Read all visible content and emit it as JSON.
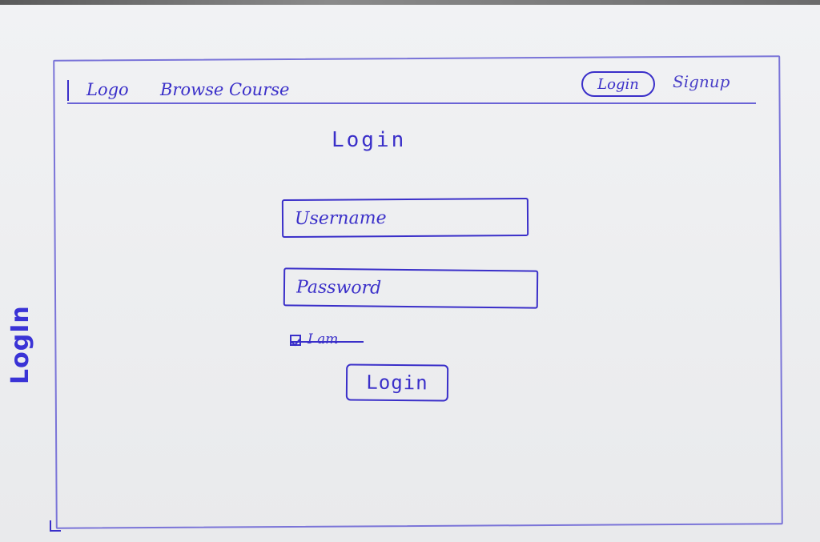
{
  "sketch": {
    "side_title": "LogIn"
  },
  "navbar": {
    "logo": "Logo",
    "browse": "Browse Course",
    "login": "Login",
    "signup": "Signup"
  },
  "form": {
    "title": "Login",
    "username_placeholder": "Username",
    "password_placeholder": "Password",
    "remember_label": "I am",
    "submit_label": "Login"
  },
  "colors": {
    "ink": "#3a2fc9",
    "frame": "#7a74d8",
    "paper": "#ebecee"
  }
}
